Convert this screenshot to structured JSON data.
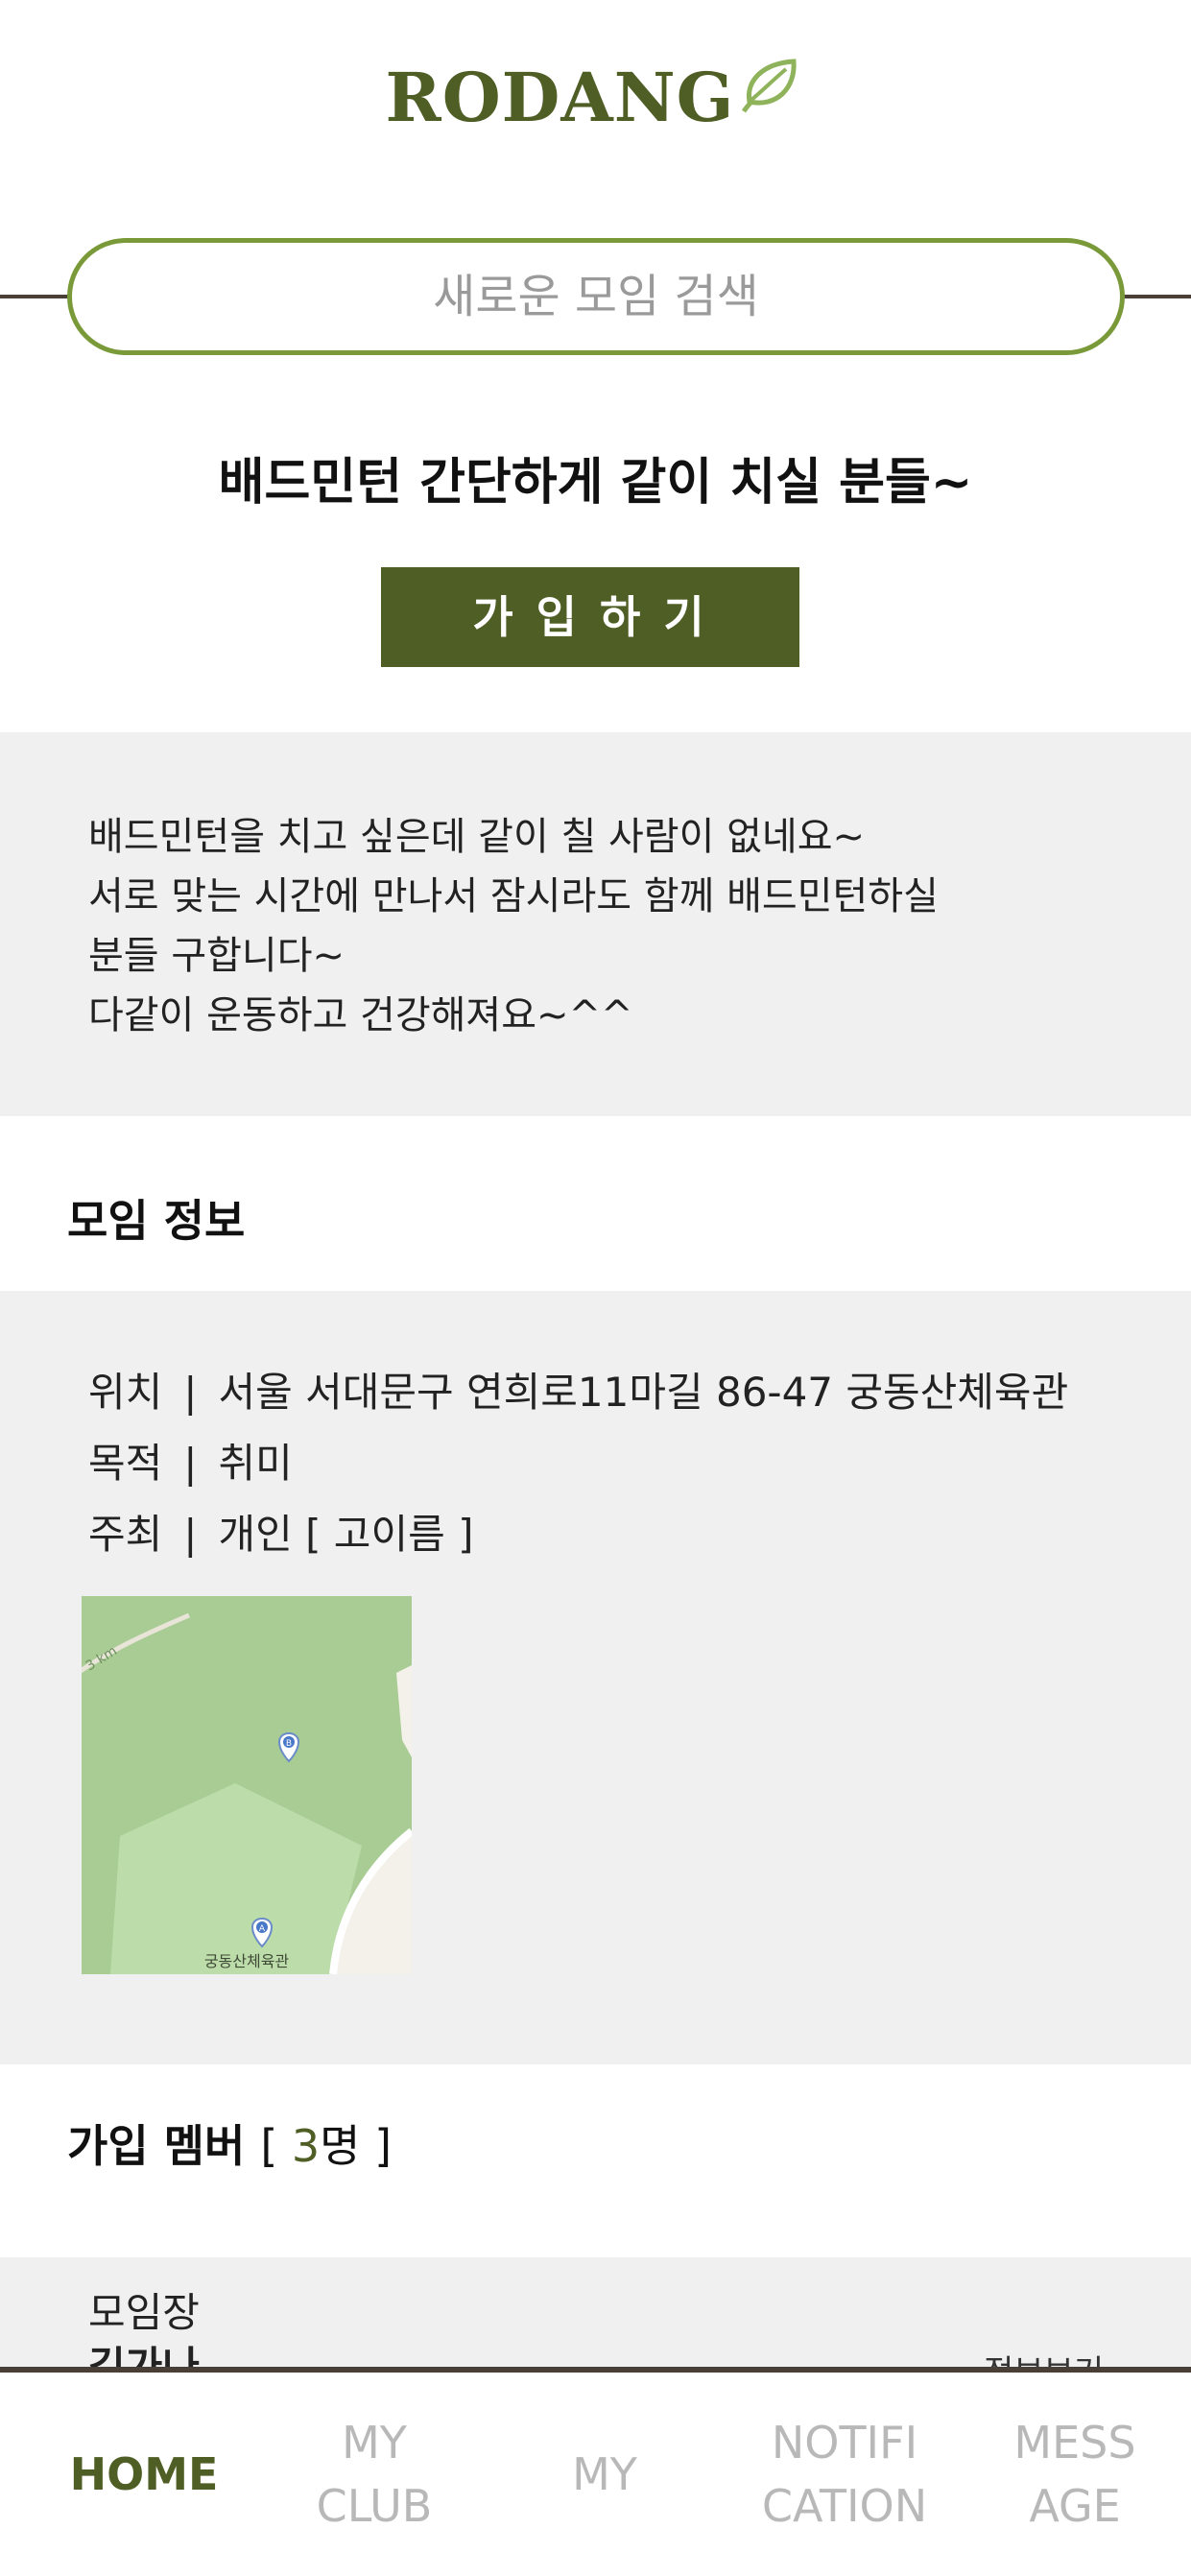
{
  "app": {
    "logo_text": "RODANG"
  },
  "search": {
    "placeholder": "새로운 모임 검색"
  },
  "club": {
    "title": "배드민턴 간단하게 같이 치실 분들~",
    "join_label": "가 입 하 기",
    "description": [
      "배드민턴을 치고 싶은데 같이 칠 사람이 없네요~",
      "서로 맞는 시간에 만나서 잠시라도 함께 배드민턴하실",
      "분들 구합니다~",
      "다같이 운동하고 건강해져요~^^"
    ]
  },
  "info": {
    "heading": "모임 정보",
    "separator": "|",
    "location_label": "위치",
    "location_value": "서울 서대문구 연희로11마길 86-47 궁동산체육관",
    "purpose_label": "목적",
    "purpose_value": "취미",
    "host_label": "주최",
    "host_value": "개인 [ 고이름 ]",
    "map": {
      "place_label": "궁동산체육관",
      "marker_a": "A",
      "marker_b": "B",
      "road_label": "3 km"
    }
  },
  "members": {
    "heading": "가입 멤버",
    "count_open": "[ ",
    "count": "3",
    "count_unit": "명",
    "count_close": " ]",
    "leader_label": "모임장",
    "leader_name": "김가나",
    "info_link": "정보보기"
  },
  "tabs": [
    {
      "line1": "HOME",
      "line2": "",
      "active": true
    },
    {
      "line1": "MY",
      "line2": "CLUB",
      "active": false
    },
    {
      "line1": "MY",
      "line2": "",
      "active": false
    },
    {
      "line1": "NOTIFI",
      "line2": "CATION",
      "active": false
    },
    {
      "line1": "MESS",
      "line2": "AGE",
      "active": false
    }
  ],
  "colors": {
    "brand_green": "#4f5e25",
    "search_border": "#7a9a3a",
    "panel_gray": "#f0f0f0",
    "divider_brown": "#4a3f36",
    "tab_inactive": "#b8b8b8"
  }
}
